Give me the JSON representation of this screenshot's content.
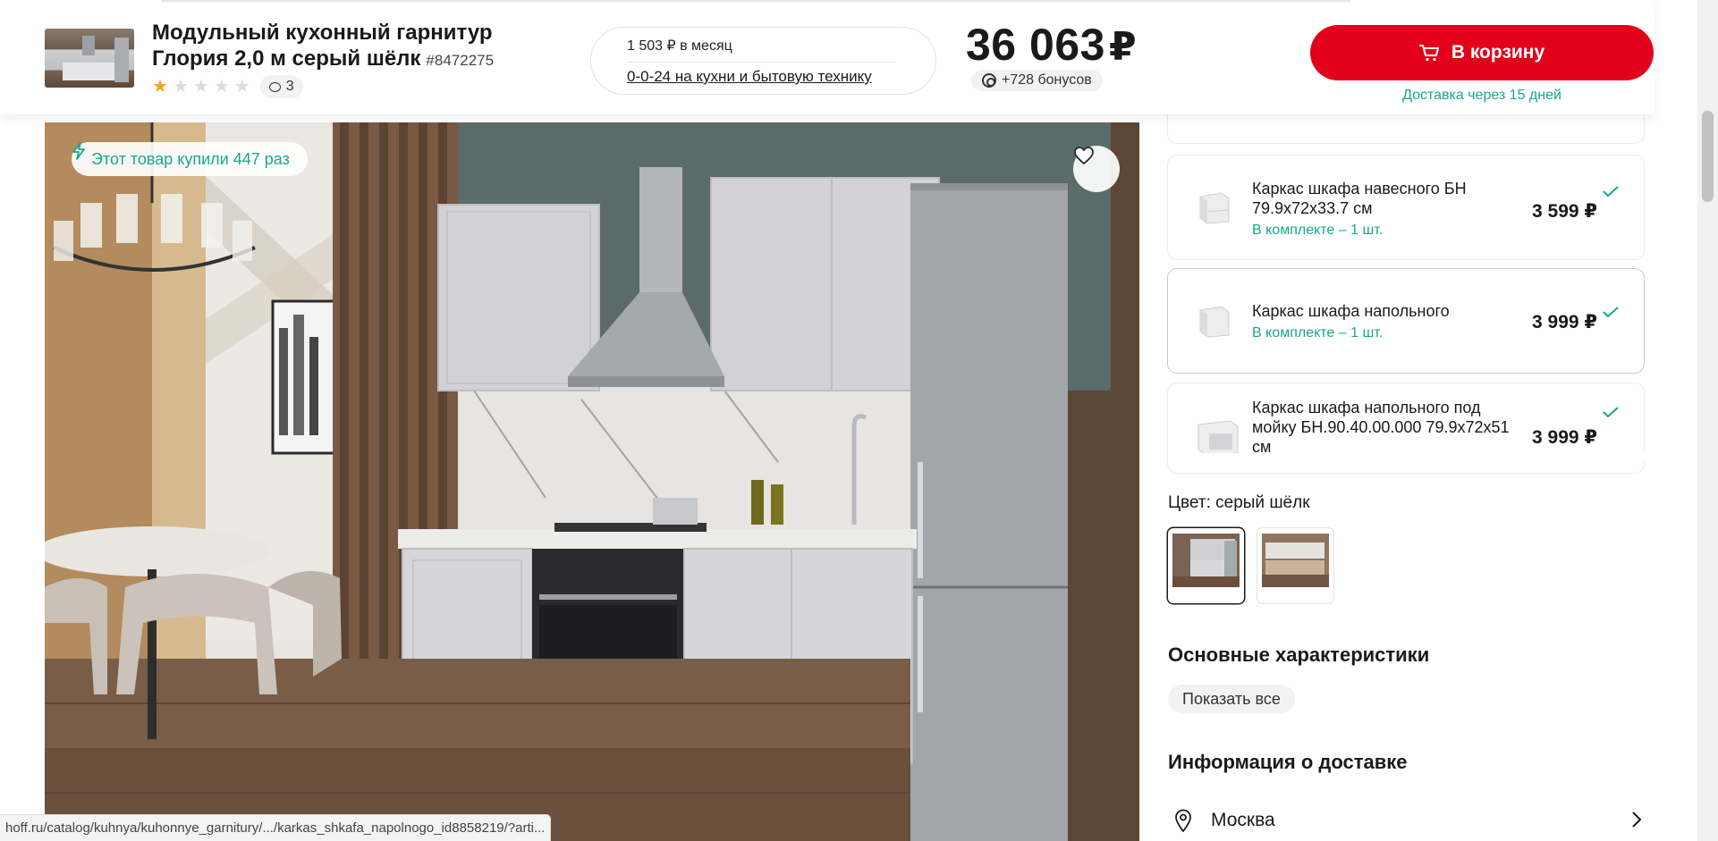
{
  "product": {
    "title": "Модульный кухонный гарнитур Глория 2,0 м серый шёлк",
    "sku": "#8472275",
    "rating_stars": 1,
    "rating_max": 5,
    "reviews_count": "3"
  },
  "installment": {
    "monthly": "1 503 ₽ в месяц",
    "offer_link": "0-0-24 на кухни и бытовую технику"
  },
  "price": {
    "value": "36 063",
    "currency": "₽",
    "bonus": "+728 бонусов"
  },
  "cart": {
    "button_label": "В корзину",
    "delivery_note": "Доставка через 15 дней"
  },
  "gallery": {
    "bought_badge": "Этот товар купили 447 раз"
  },
  "kit_items": [
    {
      "name": "Каркас шкафа навесного БН 79.9х72х33.7 см",
      "kit_label": "В комплекте – 1 шт.",
      "price": "3 599 ₽"
    },
    {
      "name": "Каркас шкафа напольного",
      "kit_label": "В комплекте – 1 шт.",
      "price": "3 999 ₽"
    },
    {
      "name": "Каркас шкафа напольного под мойку БН.90.40.00.000 79.9х72х51 см",
      "kit_label": "",
      "price": "3 999 ₽"
    }
  ],
  "color": {
    "label": "Цвет: серый шёлк",
    "selected_index": 0
  },
  "specs": {
    "title": "Основные характеристики",
    "show_all": "Показать все"
  },
  "delivery": {
    "title": "Информация о доставке",
    "city": "Москва"
  },
  "status_bar": {
    "url": "hoff.ru/catalog/kuhnya/kuhonnye_garnitury/.../karkas_shkafa_napolnogo_id8858219/?arti..."
  },
  "colors": {
    "accent_red": "#e3001b",
    "accent_green": "#18a889",
    "star_orange": "#f6a12a"
  }
}
